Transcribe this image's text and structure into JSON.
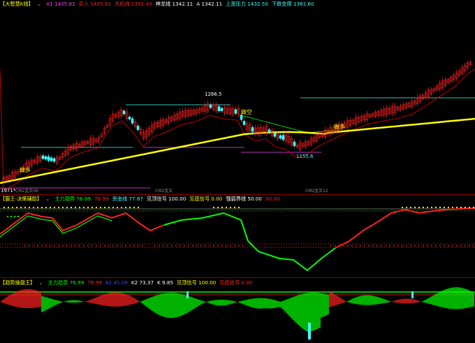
{
  "panel1": {
    "box": "【大智慧K线】",
    "items": [
      {
        "label": "A1",
        "value": "1405.81",
        "color": "#ff40ff"
      },
      {
        "label": "买入",
        "value": "1405.81",
        "color": "#ff2020"
      },
      {
        "label": "天机线",
        "value": "1391.49",
        "color": "#ff2020"
      },
      {
        "label": "神龙线",
        "value": "1342.11",
        "color": "#ffffff"
      },
      {
        "label": "A",
        "value": "1342.11",
        "color": "#ffffff"
      },
      {
        "label": "上涨压力",
        "value": "1432.50",
        "color": "#40ffff"
      },
      {
        "label": "下跌支撑",
        "value": "1361.60",
        "color": "#40ffff"
      }
    ],
    "high_label": "1266.5",
    "low_label": "1155.6",
    "left_label": "1971*",
    "signals": [
      "做多",
      "做空",
      "做多"
    ],
    "markers": [
      "CM2金叉06",
      "CM2金叉",
      "CM2金叉12"
    ]
  },
  "panel2": {
    "box": "【霸王-决策辅助】",
    "items": [
      {
        "label": "主力趋势",
        "value": "76.99",
        "color": "#00ff00"
      },
      {
        "label": "",
        "value": "76.99",
        "color": "#ff2020"
      },
      {
        "label": "资金线",
        "value": "77.87",
        "color": "#40ffff"
      },
      {
        "label": "见顶信号",
        "value": "100.00",
        "color": "#ffffff"
      },
      {
        "label": "见底信号",
        "value": "0.00",
        "color": "#ffff00"
      },
      {
        "label": "强弱界线",
        "value": "50.00",
        "color": "#ffffff"
      },
      {
        "label": "",
        "value": "50.00",
        "color": "#ff2020"
      }
    ]
  },
  "panel3": {
    "box": "【趋势操盘王】",
    "items": [
      {
        "label": "主力趋势",
        "value": "76.99",
        "color": "#00ff00"
      },
      {
        "label": "",
        "value": "76.99",
        "color": "#ff2020"
      },
      {
        "label": "",
        "value": "82.45.09",
        "color": "#4040ff"
      },
      {
        "label": "K2",
        "value": "73.37",
        "color": "#ffffff"
      },
      {
        "label": "K",
        "value": "9.85",
        "color": "#ffffff"
      },
      {
        "label": "见顶信号",
        "value": "100.00",
        "color": "#ffff00"
      },
      {
        "label": "见底信号",
        "value": "0.00",
        "color": "#ff2020"
      }
    ]
  },
  "colors": {
    "up": "#ff2020",
    "down": "#40ffff",
    "ma": "#ffff00",
    "trend_up": "#ff2020",
    "trend_down": "#00ff00"
  }
}
